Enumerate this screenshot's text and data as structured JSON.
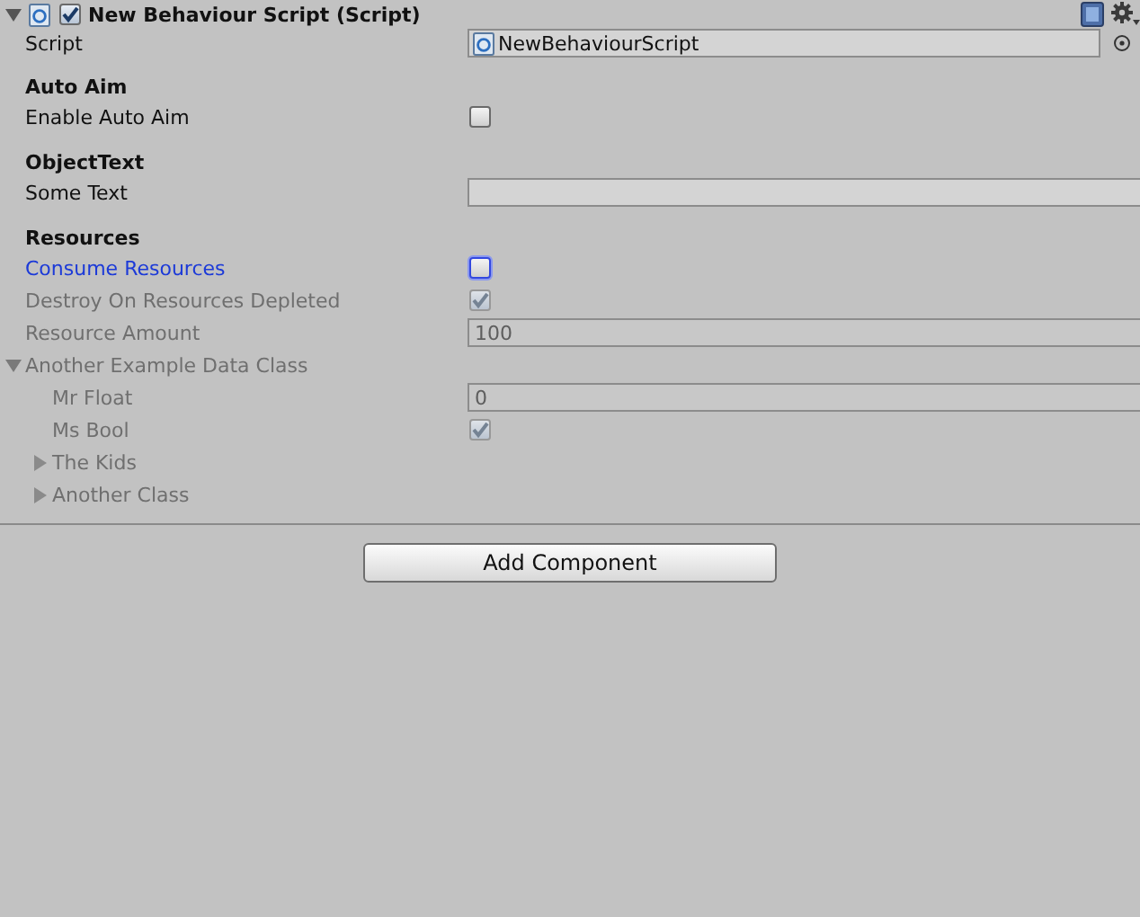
{
  "component": {
    "title": "New Behaviour Script (Script)",
    "enabled": true,
    "expanded": true
  },
  "properties": [
    {
      "kind": "object",
      "label": "Script",
      "value": "NewBehaviourScript"
    },
    {
      "kind": "header",
      "label": "Auto Aim"
    },
    {
      "kind": "checkbox",
      "label": "Enable Auto Aim",
      "checked": false,
      "disabled": false,
      "focused": false
    },
    {
      "kind": "header",
      "label": "ObjectText"
    },
    {
      "kind": "text",
      "label": "Some Text",
      "disabled": false
    },
    {
      "kind": "header",
      "label": "Resources"
    },
    {
      "kind": "checkbox",
      "label": "Consume Resources",
      "checked": false,
      "disabled": false,
      "focused": true
    },
    {
      "kind": "checkbox",
      "label": "Destroy On Resources Depleted",
      "checked": true,
      "disabled": true,
      "focused": false
    },
    {
      "kind": "text",
      "label": "Resource Amount",
      "value": "100",
      "disabled": true
    },
    {
      "kind": "foldout",
      "label": "Another Example Data Class",
      "expanded": true,
      "disabled": true,
      "children": [
        {
          "kind": "text",
          "label": "Mr Float",
          "value": "0",
          "disabled": true
        },
        {
          "kind": "checkbox",
          "label": "Ms Bool",
          "checked": true,
          "disabled": true,
          "focused": false
        },
        {
          "kind": "foldout",
          "label": "The Kids",
          "expanded": false,
          "disabled": true
        },
        {
          "kind": "foldout",
          "label": "Another Class",
          "expanded": false,
          "disabled": true
        }
      ]
    }
  ],
  "add_button": "Add Component"
}
